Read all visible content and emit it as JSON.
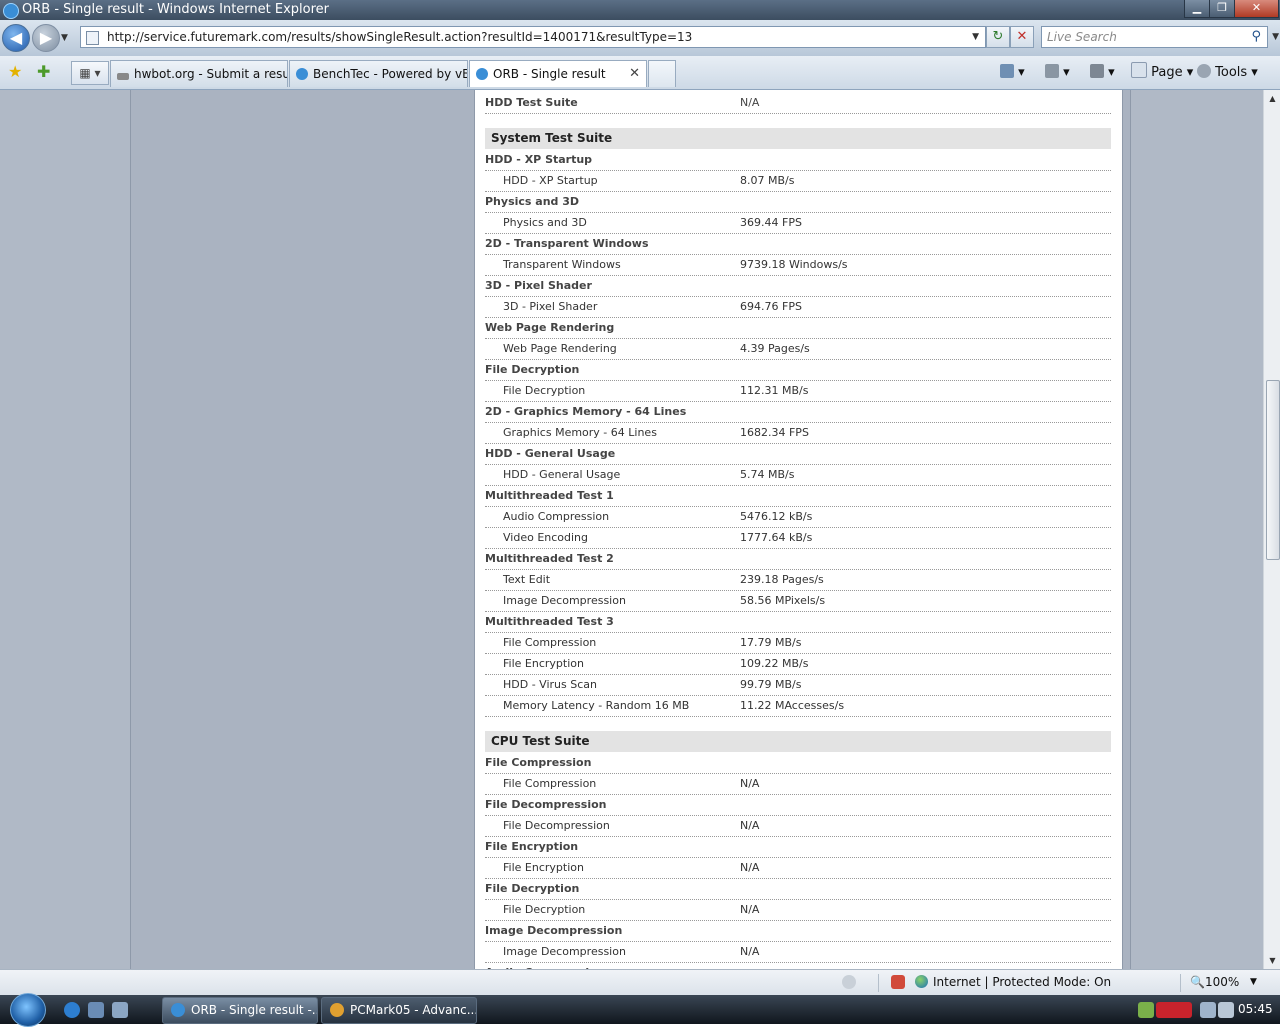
{
  "window": {
    "title": "ORB - Single result - Windows Internet Explorer"
  },
  "nav": {
    "url": "http://service.futuremark.com/results/showSingleResult.action?resultId=1400171&resultType=13",
    "search_placeholder": "Live Search"
  },
  "tabs": [
    {
      "label": "hwbot.org - Submit a result."
    },
    {
      "label": "BenchTec - Powered by vB..."
    },
    {
      "label": "ORB - Single result"
    }
  ],
  "commandbar": {
    "page": "Page",
    "tools": "Tools"
  },
  "results": {
    "hdd_suite": {
      "label": "HDD Test Suite",
      "value": "N/A"
    },
    "system_suite": {
      "title": "System Test Suite",
      "groups": [
        {
          "name": "HDD - XP Startup",
          "rows": [
            {
              "label": "HDD - XP Startup",
              "value": "8.07 MB/s"
            }
          ]
        },
        {
          "name": "Physics and 3D",
          "rows": [
            {
              "label": "Physics and 3D",
              "value": "369.44 FPS"
            }
          ]
        },
        {
          "name": "2D - Transparent Windows",
          "rows": [
            {
              "label": "Transparent Windows",
              "value": "9739.18 Windows/s"
            }
          ]
        },
        {
          "name": "3D - Pixel Shader",
          "rows": [
            {
              "label": "3D - Pixel Shader",
              "value": "694.76 FPS"
            }
          ]
        },
        {
          "name": "Web Page Rendering",
          "rows": [
            {
              "label": "Web Page Rendering",
              "value": "4.39 Pages/s"
            }
          ]
        },
        {
          "name": "File Decryption",
          "rows": [
            {
              "label": "File Decryption",
              "value": "112.31 MB/s"
            }
          ]
        },
        {
          "name": "2D - Graphics Memory - 64 Lines",
          "rows": [
            {
              "label": "Graphics Memory - 64 Lines",
              "value": "1682.34 FPS"
            }
          ]
        },
        {
          "name": "HDD - General Usage",
          "rows": [
            {
              "label": "HDD - General Usage",
              "value": "5.74 MB/s"
            }
          ]
        },
        {
          "name": "Multithreaded Test 1",
          "rows": [
            {
              "label": "Audio Compression",
              "value": "5476.12 kB/s"
            },
            {
              "label": "Video Encoding",
              "value": "1777.64 kB/s"
            }
          ]
        },
        {
          "name": "Multithreaded Test 2",
          "rows": [
            {
              "label": "Text Edit",
              "value": "239.18 Pages/s"
            },
            {
              "label": "Image Decompression",
              "value": "58.56 MPixels/s"
            }
          ]
        },
        {
          "name": "Multithreaded Test 3",
          "rows": [
            {
              "label": "File Compression",
              "value": "17.79 MB/s"
            },
            {
              "label": "File Encryption",
              "value": "109.22 MB/s"
            },
            {
              "label": "HDD - Virus Scan",
              "value": "99.79 MB/s"
            },
            {
              "label": "Memory Latency - Random 16 MB",
              "value": "11.22 MAccesses/s"
            }
          ]
        }
      ]
    },
    "cpu_suite": {
      "title": "CPU Test Suite",
      "groups": [
        {
          "name": "File Compression",
          "rows": [
            {
              "label": "File Compression",
              "value": "N/A"
            }
          ]
        },
        {
          "name": "File Decompression",
          "rows": [
            {
              "label": "File Decompression",
              "value": "N/A"
            }
          ]
        },
        {
          "name": "File Encryption",
          "rows": [
            {
              "label": "File Encryption",
              "value": "N/A"
            }
          ]
        },
        {
          "name": "File Decryption",
          "rows": [
            {
              "label": "File Decryption",
              "value": "N/A"
            }
          ]
        },
        {
          "name": "Image Decompression",
          "rows": [
            {
              "label": "Image Decompression",
              "value": "N/A"
            }
          ]
        },
        {
          "name": "Audio Compression",
          "rows": []
        }
      ]
    }
  },
  "status": {
    "zone": "Internet | Protected Mode: On",
    "zoom": "100%"
  },
  "taskbar": {
    "tasks": [
      {
        "label": "ORB - Single result -..."
      },
      {
        "label": "PCMark05 - Advanc..."
      }
    ],
    "clock": "05:45"
  }
}
